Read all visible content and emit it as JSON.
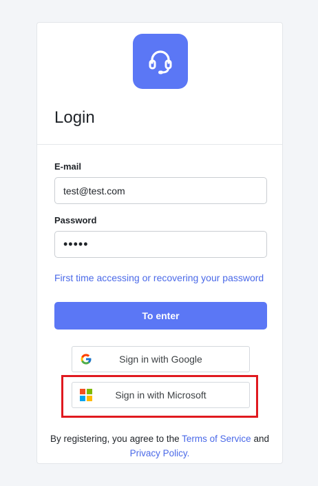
{
  "login": {
    "title": "Login",
    "email_label": "E-mail",
    "email_value": "test@test.com",
    "password_label": "Password",
    "password_value": "•••••",
    "first_access_link": "First time accessing or recovering your password",
    "enter_button": "To enter",
    "google_button": "Sign in with Google",
    "microsoft_button": "Sign in with Microsoft",
    "footer_prefix": "By registering, you agree to the",
    "terms_link": "Terms of Service",
    "footer_and": "and",
    "privacy_link": "Privacy Policy."
  },
  "icons": {
    "logo": "headset-icon",
    "google": "google-icon",
    "microsoft": "microsoft-icon"
  },
  "colors": {
    "accent": "#5b77f5",
    "link": "#4a69e8",
    "highlight": "#e0191f"
  }
}
